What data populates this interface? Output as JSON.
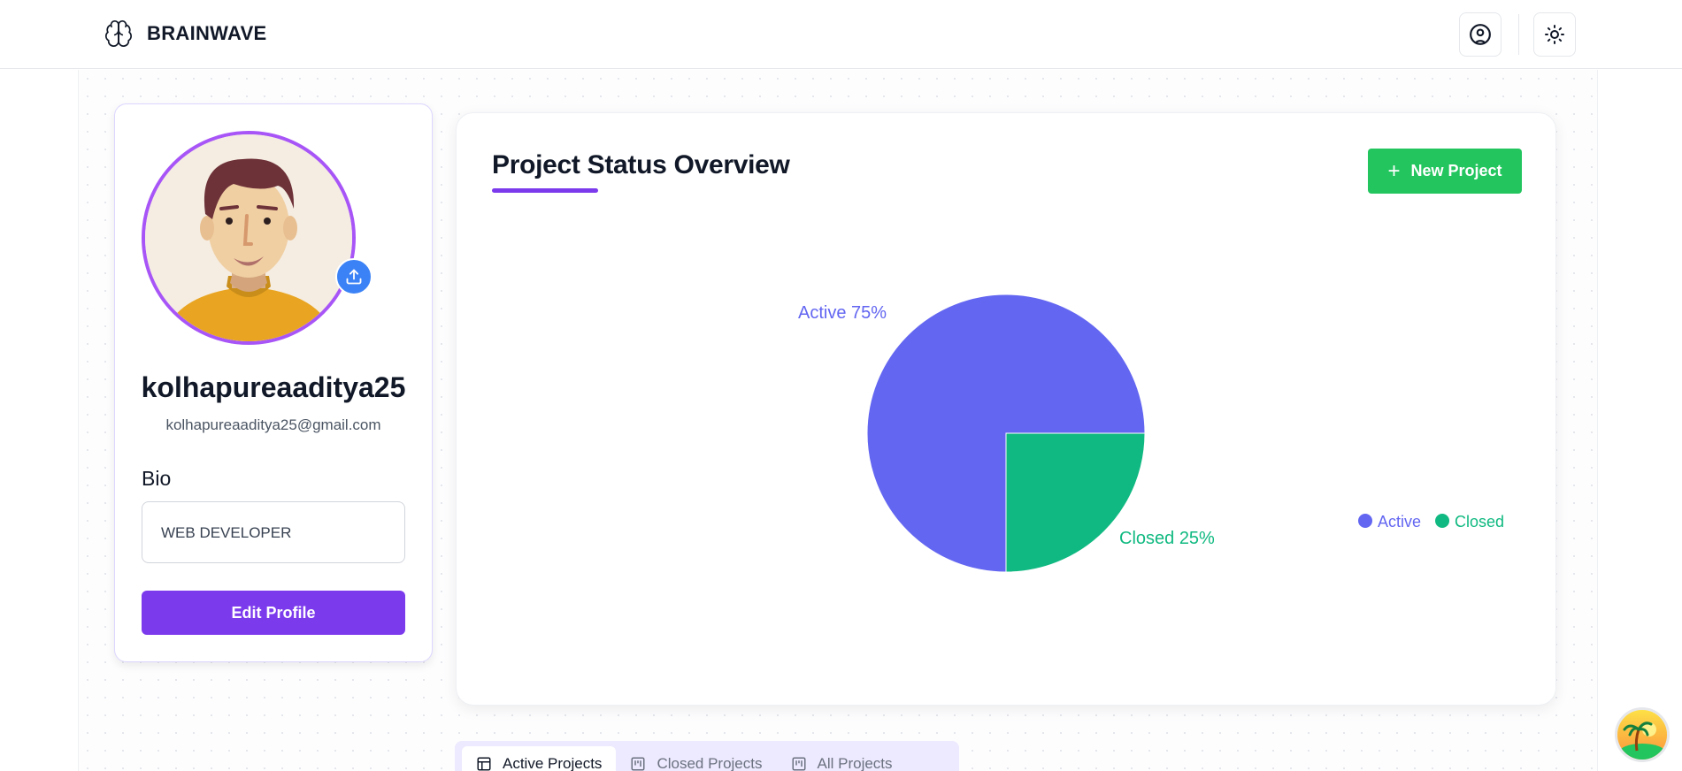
{
  "header": {
    "brand_name": "BRAINWAVE",
    "brand_icon": "brain-icon",
    "profile_icon": "user-circle-icon",
    "theme_icon": "sun-icon"
  },
  "profile": {
    "username": "kolhapureaaditya25",
    "email": "kolhapureaaditya25@gmail.com",
    "bio_label": "Bio",
    "bio_value": "WEB DEVELOPER",
    "edit_label": "Edit Profile",
    "upload_icon": "upload-icon"
  },
  "overview": {
    "title": "Project Status Overview",
    "new_project_label": "New Project",
    "accent_color": "#7c3aed"
  },
  "chart_data": {
    "type": "pie",
    "title": "",
    "slices": [
      {
        "label": "Active",
        "value": 75,
        "color": "#6366f1",
        "display": "Active 75%"
      },
      {
        "label": "Closed",
        "value": 25,
        "color": "#10b981",
        "display": "Closed 25%"
      }
    ],
    "legend": {
      "position": "bottom-right",
      "entries": [
        "Active",
        "Closed"
      ]
    }
  },
  "tabs": [
    {
      "label": "Active Projects",
      "icon": "layout-icon",
      "active": true
    },
    {
      "label": "Closed Projects",
      "icon": "kanban-icon",
      "active": false
    },
    {
      "label": "All Projects",
      "icon": "kanban-icon",
      "active": false
    }
  ]
}
